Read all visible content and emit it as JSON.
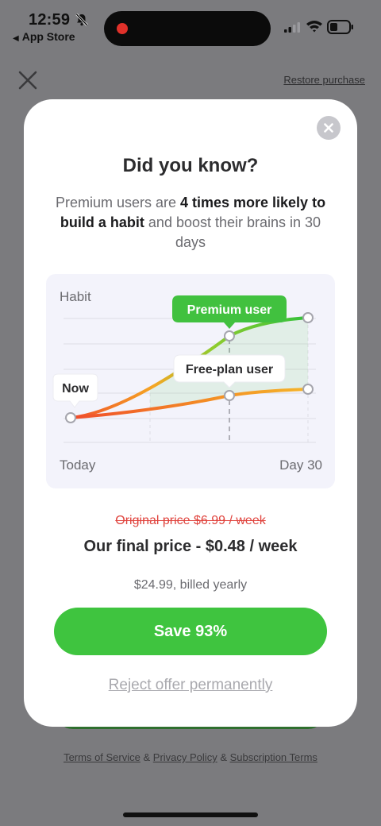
{
  "status_bar": {
    "time": "12:59",
    "back_app": "App Store",
    "recording_color": "#e0312a"
  },
  "background": {
    "restore_label": "Restore purchase",
    "legal": {
      "terms": "Terms of Service",
      "sep1": " & ",
      "privacy": "Privacy Policy",
      "sep2": " & ",
      "subscription": "Subscription Terms"
    }
  },
  "modal": {
    "title": "Did you know?",
    "desc": {
      "p1": "Premium users are ",
      "b1": "4 times more likely to build a habit",
      "p2": " and boost their brains in 30 days"
    },
    "chart": {
      "y_title": "Habit",
      "x_start": "Today",
      "x_end": "Day 30",
      "now_label": "Now",
      "premium_label": "Premium user",
      "free_label": "Free-plan user",
      "premium_color": "#41c13f",
      "free_color": "#f5a623",
      "start_color": "#f04c2c"
    },
    "original_price": "Original price $6.99 / week",
    "final_price": "Our final price - $0.48 / week",
    "billing": "$24.99, billed yearly",
    "cta_label": "Save 93%",
    "reject_label": "Reject offer permanently"
  },
  "icons": [
    "bell-slash-icon",
    "signal-icon",
    "wifi-icon",
    "battery-icon",
    "close-icon",
    "modal-close-icon"
  ]
}
